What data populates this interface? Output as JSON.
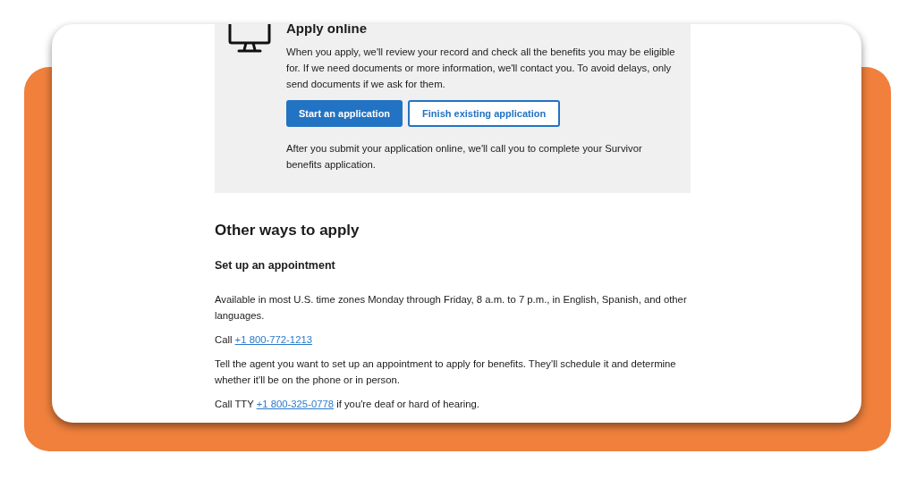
{
  "apply_online": {
    "heading": "Apply online",
    "intro": "When you apply, we'll review your record and check all the benefits you may be eligible for. If we need documents or more information, we'll contact you. To avoid delays, only send documents if we ask for them.",
    "buttons": [
      {
        "label": "Start an application",
        "kind": "primary"
      },
      {
        "label": "Finish existing application",
        "kind": "secondary"
      }
    ],
    "note": "After you submit your application online, we'll call you to complete your Survivor benefits application."
  },
  "other_ways": {
    "heading": "Other ways to apply",
    "subheading": "Set up an appointment",
    "paragraphs": [
      {
        "text": "Available in most U.S. time zones Monday through Friday, 8 a.m. to 7 p.m., in English, Spanish, and other languages."
      },
      {
        "text": "Call ",
        "link": "+1 800-772-1213"
      },
      {
        "text": "Tell the agent you want to set up an appointment to apply for benefits. They'll schedule it and determine whether it'll be on the phone or in person."
      },
      {
        "text": "Call TTY ",
        "link": "+1 800-325-0778",
        "after": " if you're deaf or hard of hearing."
      }
    ]
  }
}
